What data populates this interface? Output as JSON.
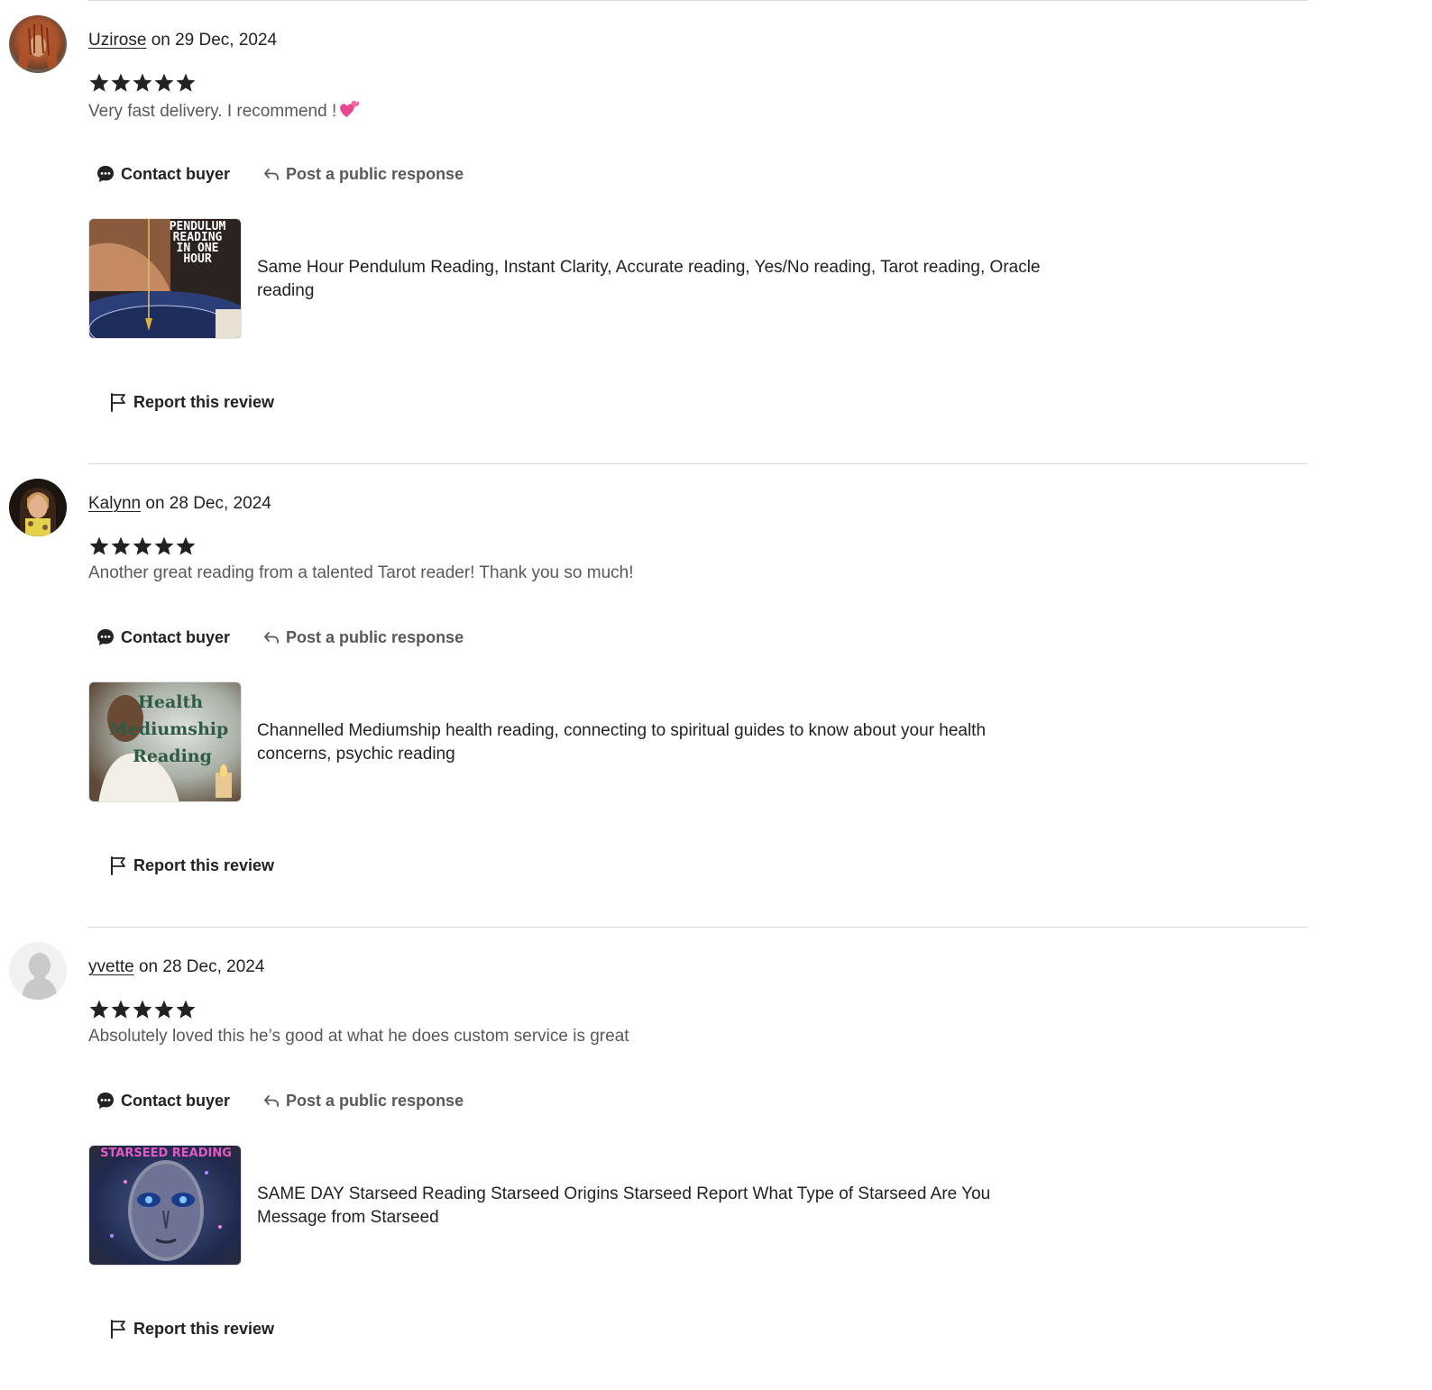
{
  "reviews": [
    {
      "reviewer": "Uzirose",
      "date_text": "on 29 Dec, 2024",
      "rating": 5,
      "text": "Very fast delivery. I recommend !",
      "text_emoji": "two-hearts-icon",
      "contact_label": "Contact buyer",
      "respond_label": "Post a public response",
      "listing_title": "Same Hour Pendulum Reading, Instant Clarity, Accurate reading, Yes/No reading, Tarot reading, Oracle reading",
      "thumb_lines": [
        "PENDULUM",
        "READING",
        "IN ONE",
        "HOUR"
      ],
      "report_label": "Report this review"
    },
    {
      "reviewer": "Kalynn",
      "date_text": "on 28 Dec, 2024",
      "rating": 5,
      "text": "Another great reading from a talented Tarot reader! Thank you so much!",
      "contact_label": "Contact buyer",
      "respond_label": "Post a public response",
      "listing_title": "Channelled Mediumship health reading, connecting to spiritual guides to know about your health concerns, psychic reading",
      "thumb_lines": [
        "Health",
        "Mediumship",
        "Reading"
      ],
      "report_label": "Report this review"
    },
    {
      "reviewer": "yvette",
      "date_text": "on 28 Dec, 2024",
      "rating": 5,
      "text": "Absolutely loved this he’s good at what he does custom service is great",
      "contact_label": "Contact buyer",
      "respond_label": "Post a public response",
      "listing_title": "SAME DAY Starseed Reading Starseed Origins Starseed Report What Type of Starseed Are You Message from Starseed",
      "thumb_lines": [
        "STARSEED READING"
      ],
      "report_label": "Report this review"
    }
  ],
  "colors": {
    "text_primary": "#222222",
    "text_secondary": "#595959",
    "divider": "#d8d8d8",
    "star": "#222222"
  }
}
